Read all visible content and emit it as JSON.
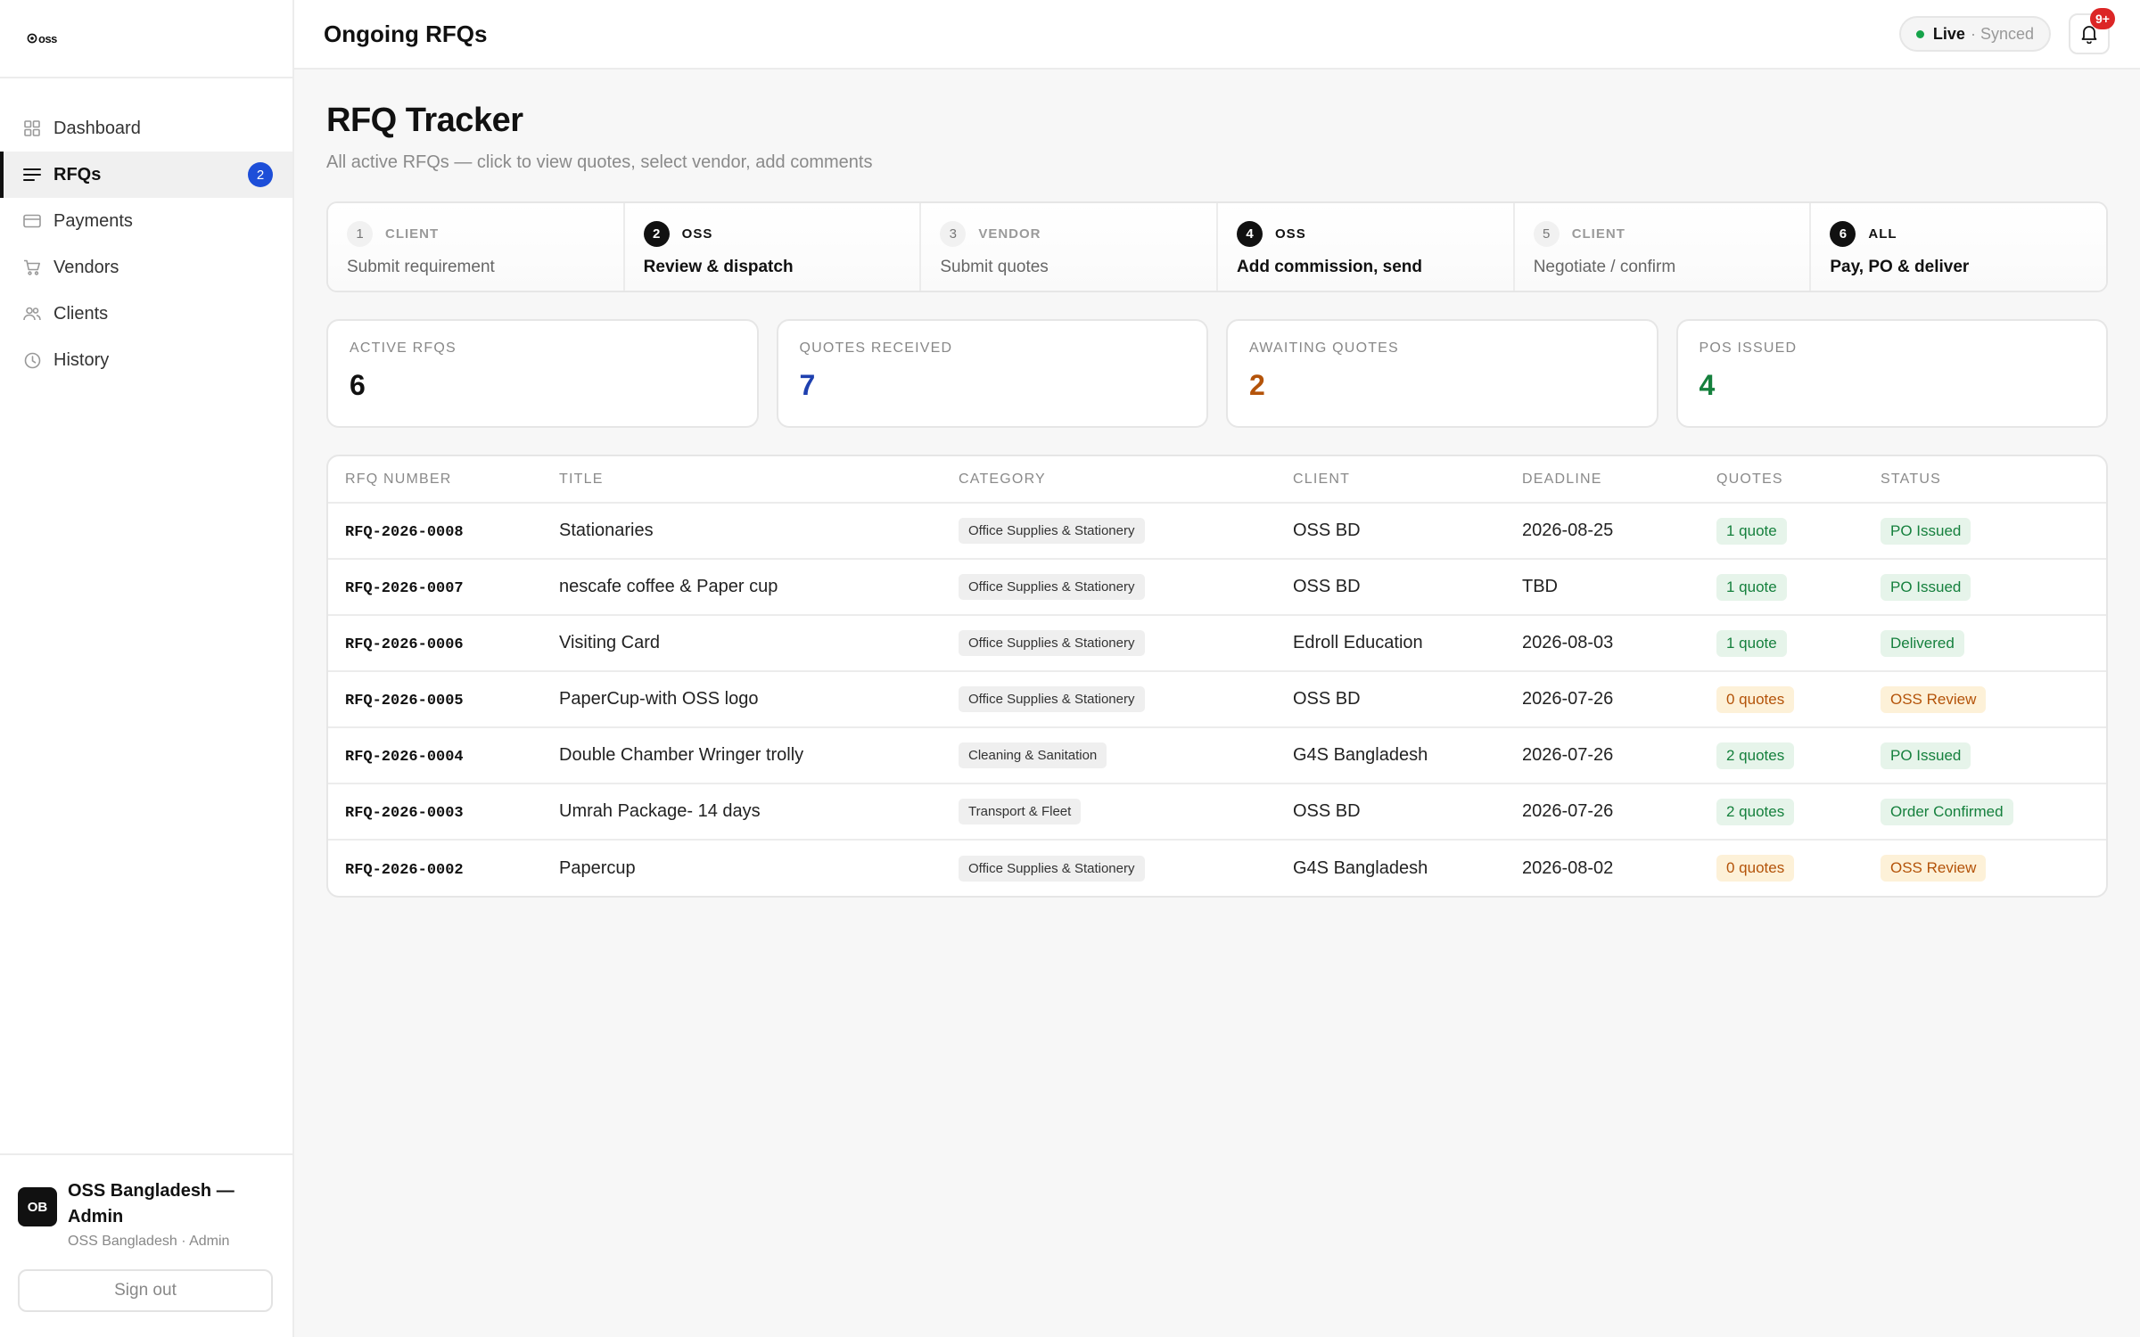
{
  "brand": {
    "logo_text": "oss"
  },
  "sidebar": {
    "items": [
      {
        "label": "Dashboard",
        "icon": "grid-icon"
      },
      {
        "label": "RFQs",
        "icon": "list-icon",
        "badge": "2",
        "active": true
      },
      {
        "label": "Payments",
        "icon": "card-icon"
      },
      {
        "label": "Vendors",
        "icon": "cart-icon"
      },
      {
        "label": "Clients",
        "icon": "users-icon"
      },
      {
        "label": "History",
        "icon": "clock-icon"
      }
    ],
    "user": {
      "initials": "OB",
      "name": "OSS Bangladesh — Admin",
      "sub": "OSS Bangladesh · Admin"
    },
    "signout_label": "Sign out"
  },
  "header": {
    "title": "Ongoing RFQs",
    "status_live": "Live",
    "status_synced": "· Synced",
    "notif_badge": "9+"
  },
  "page": {
    "title": "RFQ Tracker",
    "subtitle": "All active RFQs — click to view quotes, select vendor, add comments"
  },
  "steps": [
    {
      "num": "1",
      "role": "CLIENT",
      "desc": "Submit requirement",
      "active": false
    },
    {
      "num": "2",
      "role": "OSS",
      "desc": "Review & dispatch",
      "active": true
    },
    {
      "num": "3",
      "role": "VENDOR",
      "desc": "Submit quotes",
      "active": false
    },
    {
      "num": "4",
      "role": "OSS",
      "desc": "Add commission, send",
      "active": true
    },
    {
      "num": "5",
      "role": "CLIENT",
      "desc": "Negotiate / confirm",
      "active": false
    },
    {
      "num": "6",
      "role": "ALL",
      "desc": "Pay, PO & deliver",
      "active": true
    }
  ],
  "stats": [
    {
      "label": "ACTIVE RFQS",
      "value": "6",
      "color": "#111111"
    },
    {
      "label": "QUOTES RECEIVED",
      "value": "7",
      "color": "#1e40af"
    },
    {
      "label": "AWAITING QUOTES",
      "value": "2",
      "color": "#b45309"
    },
    {
      "label": "POS ISSUED",
      "value": "4",
      "color": "#15803d"
    }
  ],
  "table": {
    "columns": [
      "RFQ NUMBER",
      "TITLE",
      "CATEGORY",
      "CLIENT",
      "DEADLINE",
      "QUOTES",
      "STATUS"
    ],
    "rows": [
      {
        "number": "RFQ-2026-0008",
        "title": "Stationaries",
        "category": "Office Supplies & Stationery",
        "client": "OSS BD",
        "deadline": "2026-08-25",
        "quotes": "1 quote",
        "quotes_tone": "green",
        "status": "PO Issued",
        "status_tone": "green"
      },
      {
        "number": "RFQ-2026-0007",
        "title": "nescafe coffee & Paper cup",
        "category": "Office Supplies & Stationery",
        "client": "OSS BD",
        "deadline": "TBD",
        "quotes": "1 quote",
        "quotes_tone": "green",
        "status": "PO Issued",
        "status_tone": "green"
      },
      {
        "number": "RFQ-2026-0006",
        "title": "Visiting Card",
        "category": "Office Supplies & Stationery",
        "client": "Edroll Education",
        "deadline": "2026-08-03",
        "quotes": "1 quote",
        "quotes_tone": "green",
        "status": "Delivered",
        "status_tone": "green"
      },
      {
        "number": "RFQ-2026-0005",
        "title": "PaperCup-with OSS logo",
        "category": "Office Supplies & Stationery",
        "client": "OSS BD",
        "deadline": "2026-07-26",
        "quotes": "0 quotes",
        "quotes_tone": "amber",
        "status": "OSS Review",
        "status_tone": "amber"
      },
      {
        "number": "RFQ-2026-0004",
        "title": "Double Chamber Wringer trolly",
        "category": "Cleaning & Sanitation",
        "client": "G4S Bangladesh",
        "deadline": "2026-07-26",
        "quotes": "2 quotes",
        "quotes_tone": "green",
        "status": "PO Issued",
        "status_tone": "green"
      },
      {
        "number": "RFQ-2026-0003",
        "title": "Umrah Package- 14 days",
        "category": "Transport & Fleet",
        "client": "OSS BD",
        "deadline": "2026-07-26",
        "quotes": "2 quotes",
        "quotes_tone": "green",
        "status": "Order Confirmed",
        "status_tone": "green"
      },
      {
        "number": "RFQ-2026-0002",
        "title": "Papercup",
        "category": "Office Supplies & Stationery",
        "client": "G4S Bangladesh",
        "deadline": "2026-08-02",
        "quotes": "0 quotes",
        "quotes_tone": "amber",
        "status": "OSS Review",
        "status_tone": "amber"
      }
    ]
  },
  "tones": {
    "green": {
      "bg": "#e6f4ea",
      "fg": "#15803d"
    },
    "amber": {
      "bg": "#fdf1d8",
      "fg": "#b45309"
    }
  }
}
